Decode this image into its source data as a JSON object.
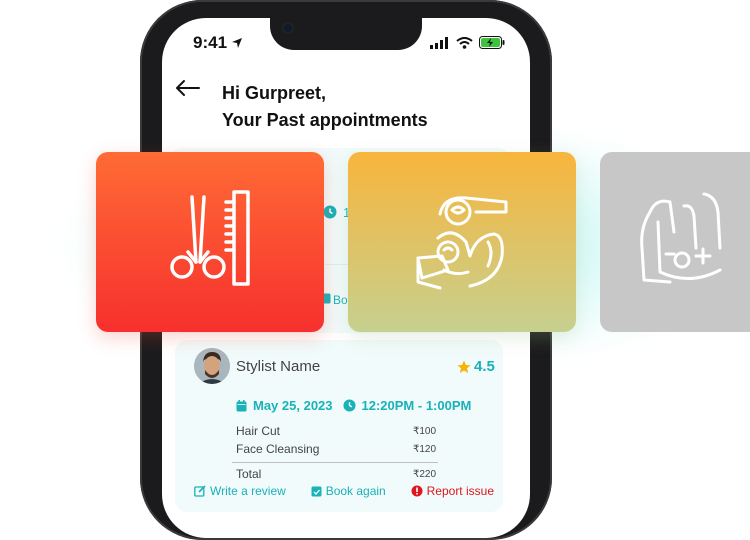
{
  "status_bar": {
    "time": "9:41"
  },
  "header": {
    "greeting": "Hi Gurpreet,",
    "subtitle": "Your Past appointments"
  },
  "previous_card": {
    "time_fragment": "1",
    "action_fragment": "Boo"
  },
  "appointment": {
    "stylist_name": "Stylist Name",
    "rating": "4.5",
    "date": "May 25, 2023",
    "time": "12:20PM - 1:00PM",
    "items": [
      {
        "name": "Hair Cut",
        "price": "₹100"
      },
      {
        "name": "Face Cleansing",
        "price": "₹120"
      }
    ],
    "total_label": "Total",
    "total_value": "₹220",
    "actions": {
      "review": "Write a review",
      "book_again": "Book again",
      "report": "Report issue"
    }
  },
  "services": [
    {
      "icon": "scissors-comb-icon",
      "color": "#f7302e"
    },
    {
      "icon": "facial-spa-icon",
      "color": "#f8b53c"
    },
    {
      "icon": "hand-care-icon",
      "color": "#c7c7c7"
    }
  ],
  "colors": {
    "accent": "#18b2b8",
    "danger": "#e0161e",
    "star": "#f5b400"
  }
}
